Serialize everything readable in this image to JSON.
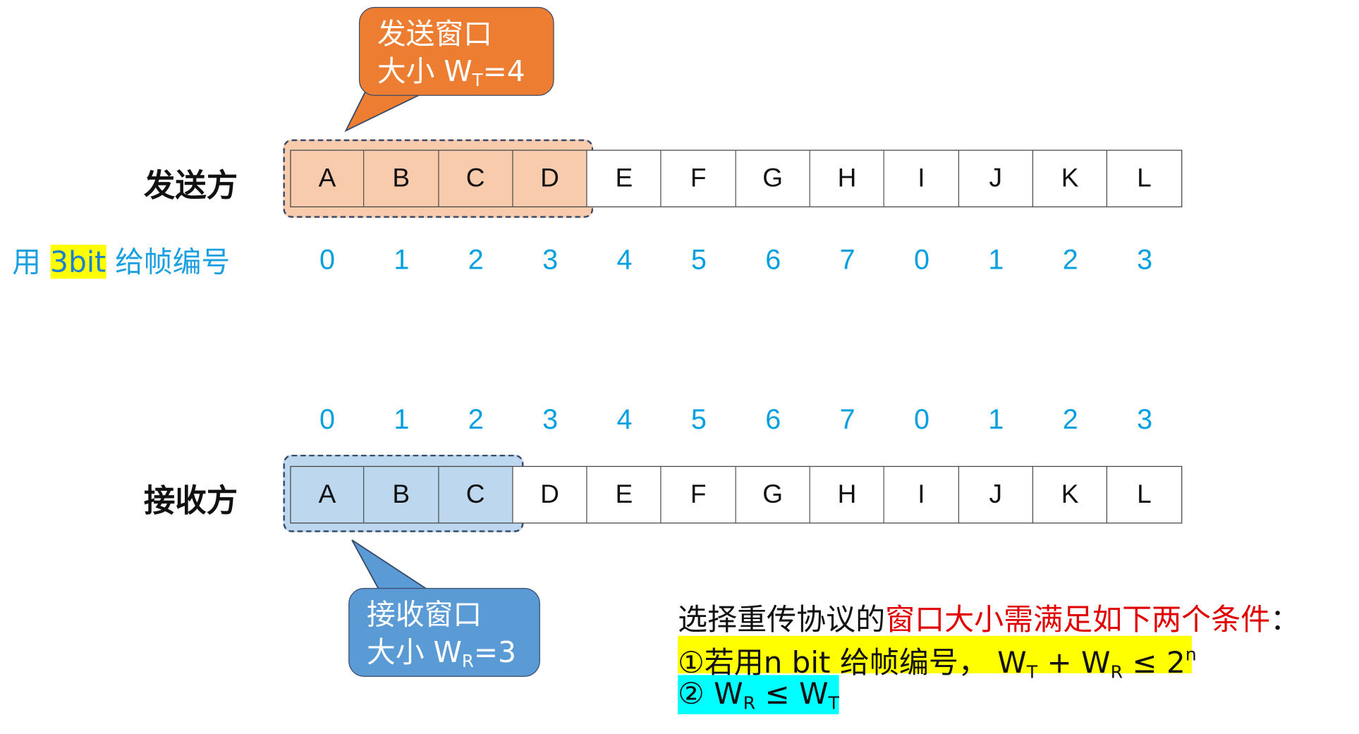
{
  "colors": {
    "sender_window": "#f8cbad",
    "receiver_window": "#bdd7ee",
    "sender_bubble": "#ed7d31",
    "receiver_bubble": "#5b9bd5",
    "number_color": "#00a0e0",
    "highlight_yellow": "#ffff00",
    "highlight_cyan": "#00ffff",
    "emphasis_red": "#e00000"
  },
  "sender": {
    "label": "发送方",
    "bubble": {
      "line1": "发送窗口",
      "line2_prefix": "大小 W",
      "line2_sub": "T",
      "line2_suffix": "=4"
    },
    "frames": [
      "A",
      "B",
      "C",
      "D",
      "E",
      "F",
      "G",
      "H",
      "I",
      "J",
      "K",
      "L"
    ],
    "window_size": 4,
    "numbering_label": {
      "prefix": "用 ",
      "highlight": "3bit",
      "suffix": " 给帧编号"
    },
    "seq_numbers": [
      "0",
      "1",
      "2",
      "3",
      "4",
      "5",
      "6",
      "7",
      "0",
      "1",
      "2",
      "3"
    ]
  },
  "receiver": {
    "label": "接收方",
    "bubble": {
      "line1": "接收窗口",
      "line2_prefix": "大小 W",
      "line2_sub": "R",
      "line2_suffix": "=3"
    },
    "frames": [
      "A",
      "B",
      "C",
      "D",
      "E",
      "F",
      "G",
      "H",
      "I",
      "J",
      "K",
      "L"
    ],
    "window_size": 3,
    "seq_numbers": [
      "0",
      "1",
      "2",
      "3",
      "4",
      "5",
      "6",
      "7",
      "0",
      "1",
      "2",
      "3"
    ]
  },
  "conditions": {
    "intro_black": "选择重传协议的",
    "intro_red": "窗口大小需满足如下两个条件",
    "intro_colon": "：",
    "c1": {
      "text": "①若用n bit  给帧编号，  W",
      "sub1": "T",
      "plus": " + W",
      "sub2": "R",
      "le": " ≤ 2",
      "sup": "n"
    },
    "c2": {
      "text": "② W",
      "sub1": "R",
      "le": " ≤  W",
      "sub2": "T"
    }
  }
}
